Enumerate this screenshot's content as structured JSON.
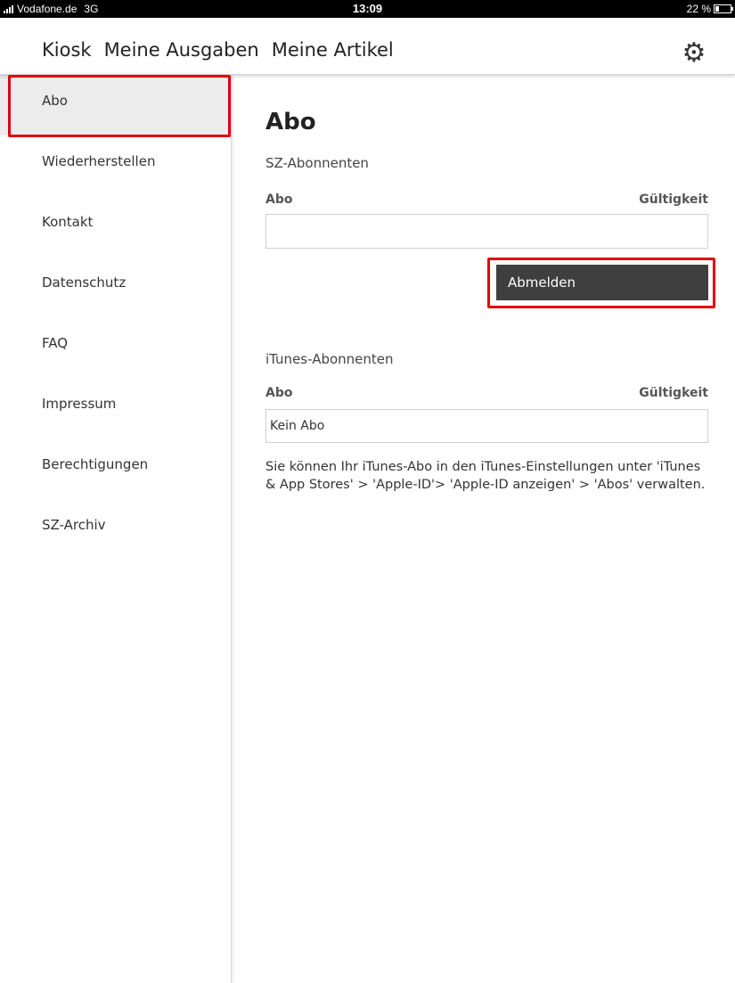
{
  "status_bar": {
    "carrier": "Vodafone.de",
    "network": "3G",
    "time": "13:09",
    "battery": "22 %",
    "battery_level": 0.22
  },
  "nav": {
    "tabs": [
      {
        "label": "Kiosk"
      },
      {
        "label": "Meine Ausgaben"
      },
      {
        "label": "Meine Artikel"
      }
    ],
    "settings_icon": "gear-icon"
  },
  "sidebar": {
    "items": [
      {
        "label": "Abo",
        "active": true
      },
      {
        "label": "Wiederherstellen"
      },
      {
        "label": "Kontakt"
      },
      {
        "label": "Datenschutz"
      },
      {
        "label": "FAQ"
      },
      {
        "label": "Impressum"
      },
      {
        "label": "Berechtigungen"
      },
      {
        "label": "SZ-Archiv"
      }
    ]
  },
  "main": {
    "title": "Abo",
    "sz_section": {
      "title": "SZ-Abonnenten",
      "col_abo": "Abo",
      "col_validity": "Gültigkeit",
      "field_value": "",
      "logout_button": "Abmelden"
    },
    "itunes_section": {
      "title": "iTunes-Abonnenten",
      "col_abo": "Abo",
      "col_validity": "Gültigkeit",
      "field_value": "Kein Abo",
      "info": "Sie können Ihr iTunes-Abo in den iTunes-Einstellungen unter 'iTunes & App Stores' > 'Apple-ID'> 'Apple-ID anzeigen' > 'Abos' verwalten."
    }
  },
  "colors": {
    "highlight": "#e10010",
    "button_bg": "#3f3f3f",
    "active_item_bg": "#ececec"
  }
}
